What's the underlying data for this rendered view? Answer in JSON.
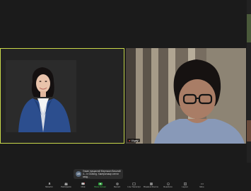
{
  "participants": {
    "right_tile_name": "Ulgay"
  },
  "chat_toast": {
    "avatar_initials": "UB",
    "text": "Улаан хувцастай Мэргэжил багштай 4... Iv Outlong. Хамтрагчаар сэтгэл хаад..."
  },
  "toolbar": {
    "items": [
      {
        "label": "Mute/Un",
        "icon": "microphone-icon"
      },
      {
        "label": "Participants",
        "icon": "participants-icon"
      },
      {
        "label": "Chat",
        "icon": "chat-icon"
      },
      {
        "label": "Share Screen",
        "icon": "share-screen-icon"
      },
      {
        "label": "Record",
        "icon": "record-icon"
      },
      {
        "label": "Live Transcript",
        "icon": "captions-icon"
      },
      {
        "label": "Breakout Rooms",
        "icon": "breakout-icon"
      },
      {
        "label": "Reactions",
        "icon": "reactions-icon"
      },
      {
        "label": "Layout",
        "icon": "layout-icon"
      },
      {
        "label": "More",
        "icon": "more-icon"
      }
    ],
    "participants_count": "2",
    "chat_badge": "1"
  },
  "colors": {
    "active_speaker_border": "#c9d84a",
    "share_green": "#2d9b3a"
  }
}
